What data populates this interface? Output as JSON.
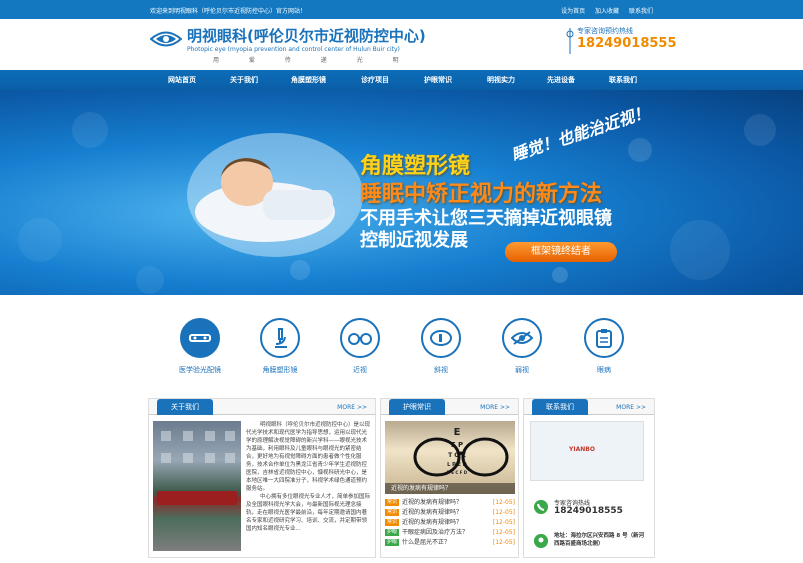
{
  "topbar": {
    "welcome": "欢迎来到明视眼科（呼伦贝尔市近视防控中心）官方网站！",
    "links": [
      "设为首页",
      "加入收藏",
      "联系我们"
    ]
  },
  "header": {
    "title": "明视眼科(呼伦贝尔市近视防控中心)",
    "subtitle": "Photopic eye (myopia prevention and control center of Hulun Buir city)",
    "motto": "用 爱 传 递 光 明",
    "phone_label": "专家咨询预约热线",
    "phone": "18249018555"
  },
  "nav": [
    "网站首页",
    "关于我们",
    "角膜塑形镜",
    "诊疗项目",
    "护眼常识",
    "明视实力",
    "先进设备",
    "联系我们"
  ],
  "banner": {
    "slogan": "睡觉！也能治近视！",
    "line1": "角膜塑形镜",
    "line2": "睡眠中矫正视力的新方法",
    "line3": "不用手术让您三天摘掉近视眼镜",
    "line4": "控制近视发展",
    "button": "框架镜终结者"
  },
  "services": [
    {
      "label": "医学验光配镜",
      "icon": "optometry-icon"
    },
    {
      "label": "角膜塑形镜",
      "icon": "microscope-icon"
    },
    {
      "label": "近视",
      "icon": "glasses-icon"
    },
    {
      "label": "斜视",
      "icon": "eye-icon"
    },
    {
      "label": "弱视",
      "icon": "eye-slash-icon"
    },
    {
      "label": "眼病",
      "icon": "clipboard-icon"
    }
  ],
  "about": {
    "tab": "关于我们",
    "more": "MORE >>",
    "p1": "明视眼科（呼伦贝尔市近视防控中心）是以现代光学技术和现代医学为指导思想，运用以现代光学的原理解决视觉障碍的新兴学科——眼视光技术为基础，利用眼科及儿童眼科与眼视光的紧密结合，更好地为有视觉障碍方面的患者做个性化服务，技术合作单位为黑龙江省青少年学生近视防控医院，吉林省近视防控中心，慷视科研光中心，是本地区唯一大四院准分子，科视学术绿色通道预约服务站。",
    "p2": "中心拥有多位眼视光专业人才，简单参加国际及全国眼科视光学大会，与最新国际视光理念接轨，走在眼视光医学最前沿，每年定期邀请国内著名专家和近视研究学习、培训、交流，并定期带领国内知名眼视光专业..."
  },
  "news": {
    "tab": "护眼常识",
    "more": "MORE >>",
    "caption": "近视的发病有规律吗？",
    "items": [
      {
        "tag": "常识",
        "tag_color": "#f08a00",
        "title": "近视的发病有规律吗？",
        "date": "[12-05]"
      },
      {
        "tag": "常识",
        "tag_color": "#f08a00",
        "title": "近视的发病有规律吗？",
        "date": "[12-05]"
      },
      {
        "tag": "常识",
        "tag_color": "#f08a00",
        "title": "近视的发病有规律吗？",
        "date": "[12-05]"
      },
      {
        "tag": "护眼",
        "tag_color": "#3ba84a",
        "title": "干眼症病因及治疗方法？",
        "date": "[12-05]"
      },
      {
        "tag": "护眼",
        "tag_color": "#3ba84a",
        "title": "什么是屈光不正？",
        "date": "[12-05]"
      }
    ]
  },
  "contact": {
    "tab": "联系我们",
    "more": "MORE >>",
    "map_brand": "YIANBO",
    "hotline_label": "专家咨询热线",
    "hotline": "18249018555",
    "address": "地址：海拉尔区兴安西路 8 号（新河西路百盛商场北侧）"
  }
}
